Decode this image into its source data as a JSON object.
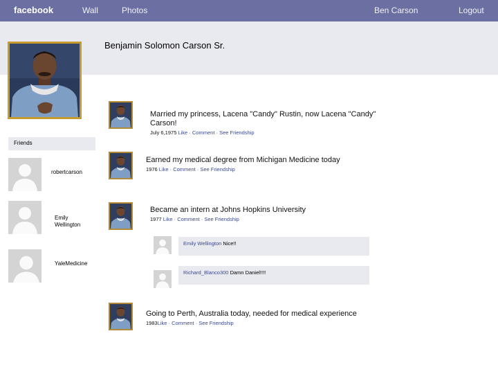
{
  "nav": {
    "brand": "facebook",
    "wall": "Wall",
    "photos": "Photos",
    "user": "Ben Carson",
    "logout": "Logout"
  },
  "profile": {
    "name": "Benjamin Solomon Carson Sr."
  },
  "friends": {
    "heading": "Friends",
    "items": [
      {
        "name": "robertcarson"
      },
      {
        "name": "Emily\nWellington"
      },
      {
        "name": "YaleMedicine"
      }
    ]
  },
  "posts": [
    {
      "text": "Married my princess, Lacena \"Candy\" Rustin, now Lacena \"Candy\" Carson!",
      "date": "July 6,1975",
      "actions": "Like · Comment · See Friendship"
    },
    {
      "text": "Earned my medical degree from Michigan Medicine today",
      "date": "1976",
      "actions": "Like · Comment · See Friendship"
    },
    {
      "text": "Became an intern at Johns Hopkins University",
      "date": "1977",
      "actions": "Like · Comment · See Friendship",
      "comments": [
        {
          "author": "Emily Wellington",
          "text": "Nice!!"
        },
        {
          "author": "Richard_Blanco300",
          "text": "Damn Daniel!!!!"
        }
      ]
    },
    {
      "text": "Going to Perth, Australia today, needed for medical experience",
      "date": "1983",
      "actions": "Like · Comment · See Friendship"
    }
  ],
  "colors": {
    "topbar": "#6b6fa2",
    "banner": "#e9e9f0",
    "link": "#3b4a8f",
    "photo_frame": "#c79a2e"
  }
}
